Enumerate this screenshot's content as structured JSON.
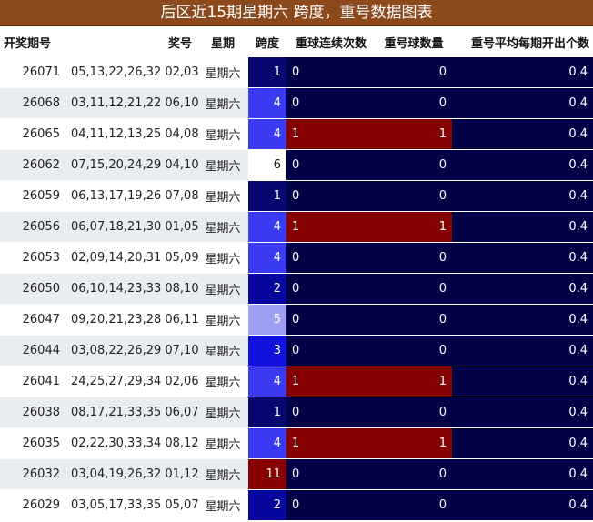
{
  "title": "后区近15期星期六  跨度，重号数据图表",
  "headers": [
    "开奖期号",
    "奖号",
    "星期",
    "跨度",
    "重球连续次数",
    "重号球数量",
    "重号平均每期开出个数"
  ],
  "colors": {
    "dark_navy": "#010147",
    "blue_4": "#3a3af2",
    "blue_3": "#1111e0",
    "blue_2": "#07079e",
    "blue_1": "#070770",
    "light_5": "#9fa0f5",
    "white_6": "#ffffff",
    "dark_red": "#860102"
  },
  "rows": [
    {
      "issue": "26071",
      "numbers": "05,13,22,26,32 02,03",
      "weekday": "星期六",
      "span": "1",
      "consecutive": "0",
      "repeat_count": "0",
      "avg": "0.4",
      "span_color": "#070770",
      "hit": false
    },
    {
      "issue": "26068",
      "numbers": "03,11,12,21,22 06,10",
      "weekday": "星期六",
      "span": "4",
      "consecutive": "0",
      "repeat_count": "0",
      "avg": "0.4",
      "span_color": "#3a3af2",
      "hit": false
    },
    {
      "issue": "26065",
      "numbers": "04,11,12,13,25 04,08",
      "weekday": "星期六",
      "span": "4",
      "consecutive": "1",
      "repeat_count": "1",
      "avg": "0.4",
      "span_color": "#3a3af2",
      "hit": true
    },
    {
      "issue": "26062",
      "numbers": "07,15,20,24,29 04,10",
      "weekday": "星期六",
      "span": "6",
      "consecutive": "0",
      "repeat_count": "0",
      "avg": "0.4",
      "span_color": "#ffffff",
      "hit": false
    },
    {
      "issue": "26059",
      "numbers": "06,13,17,19,26 07,08",
      "weekday": "星期六",
      "span": "1",
      "consecutive": "0",
      "repeat_count": "0",
      "avg": "0.4",
      "span_color": "#070770",
      "hit": false
    },
    {
      "issue": "26056",
      "numbers": "06,07,18,21,30 01,05",
      "weekday": "星期六",
      "span": "4",
      "consecutive": "1",
      "repeat_count": "1",
      "avg": "0.4",
      "span_color": "#3a3af2",
      "hit": true
    },
    {
      "issue": "26053",
      "numbers": "02,09,14,20,31 05,09",
      "weekday": "星期六",
      "span": "4",
      "consecutive": "0",
      "repeat_count": "0",
      "avg": "0.4",
      "span_color": "#3a3af2",
      "hit": false
    },
    {
      "issue": "26050",
      "numbers": "06,10,14,23,33 08,10",
      "weekday": "星期六",
      "span": "2",
      "consecutive": "0",
      "repeat_count": "0",
      "avg": "0.4",
      "span_color": "#07079e",
      "hit": false
    },
    {
      "issue": "26047",
      "numbers": "09,20,21,23,28 06,11",
      "weekday": "星期六",
      "span": "5",
      "consecutive": "0",
      "repeat_count": "0",
      "avg": "0.4",
      "span_color": "#9fa0f5",
      "hit": false
    },
    {
      "issue": "26044",
      "numbers": "03,08,22,26,29 07,10",
      "weekday": "星期六",
      "span": "3",
      "consecutive": "0",
      "repeat_count": "0",
      "avg": "0.4",
      "span_color": "#1111e0",
      "hit": false
    },
    {
      "issue": "26041",
      "numbers": "24,25,27,29,34 02,06",
      "weekday": "星期六",
      "span": "4",
      "consecutive": "1",
      "repeat_count": "1",
      "avg": "0.4",
      "span_color": "#3a3af2",
      "hit": true
    },
    {
      "issue": "26038",
      "numbers": "08,17,21,33,35 06,07",
      "weekday": "星期六",
      "span": "1",
      "consecutive": "0",
      "repeat_count": "0",
      "avg": "0.4",
      "span_color": "#070770",
      "hit": false
    },
    {
      "issue": "26035",
      "numbers": "02,22,30,33,34 08,12",
      "weekday": "星期六",
      "span": "4",
      "consecutive": "1",
      "repeat_count": "1",
      "avg": "0.4",
      "span_color": "#3a3af2",
      "hit": true
    },
    {
      "issue": "26032",
      "numbers": "03,04,19,26,32 01,12",
      "weekday": "星期六",
      "span": "11",
      "consecutive": "0",
      "repeat_count": "0",
      "avg": "0.4",
      "span_color": "#860102",
      "hit": false
    },
    {
      "issue": "26029",
      "numbers": "03,05,17,33,35 05,07",
      "weekday": "星期六",
      "span": "2",
      "consecutive": "0",
      "repeat_count": "0",
      "avg": "0.4",
      "span_color": "#07079e",
      "hit": false
    }
  ]
}
